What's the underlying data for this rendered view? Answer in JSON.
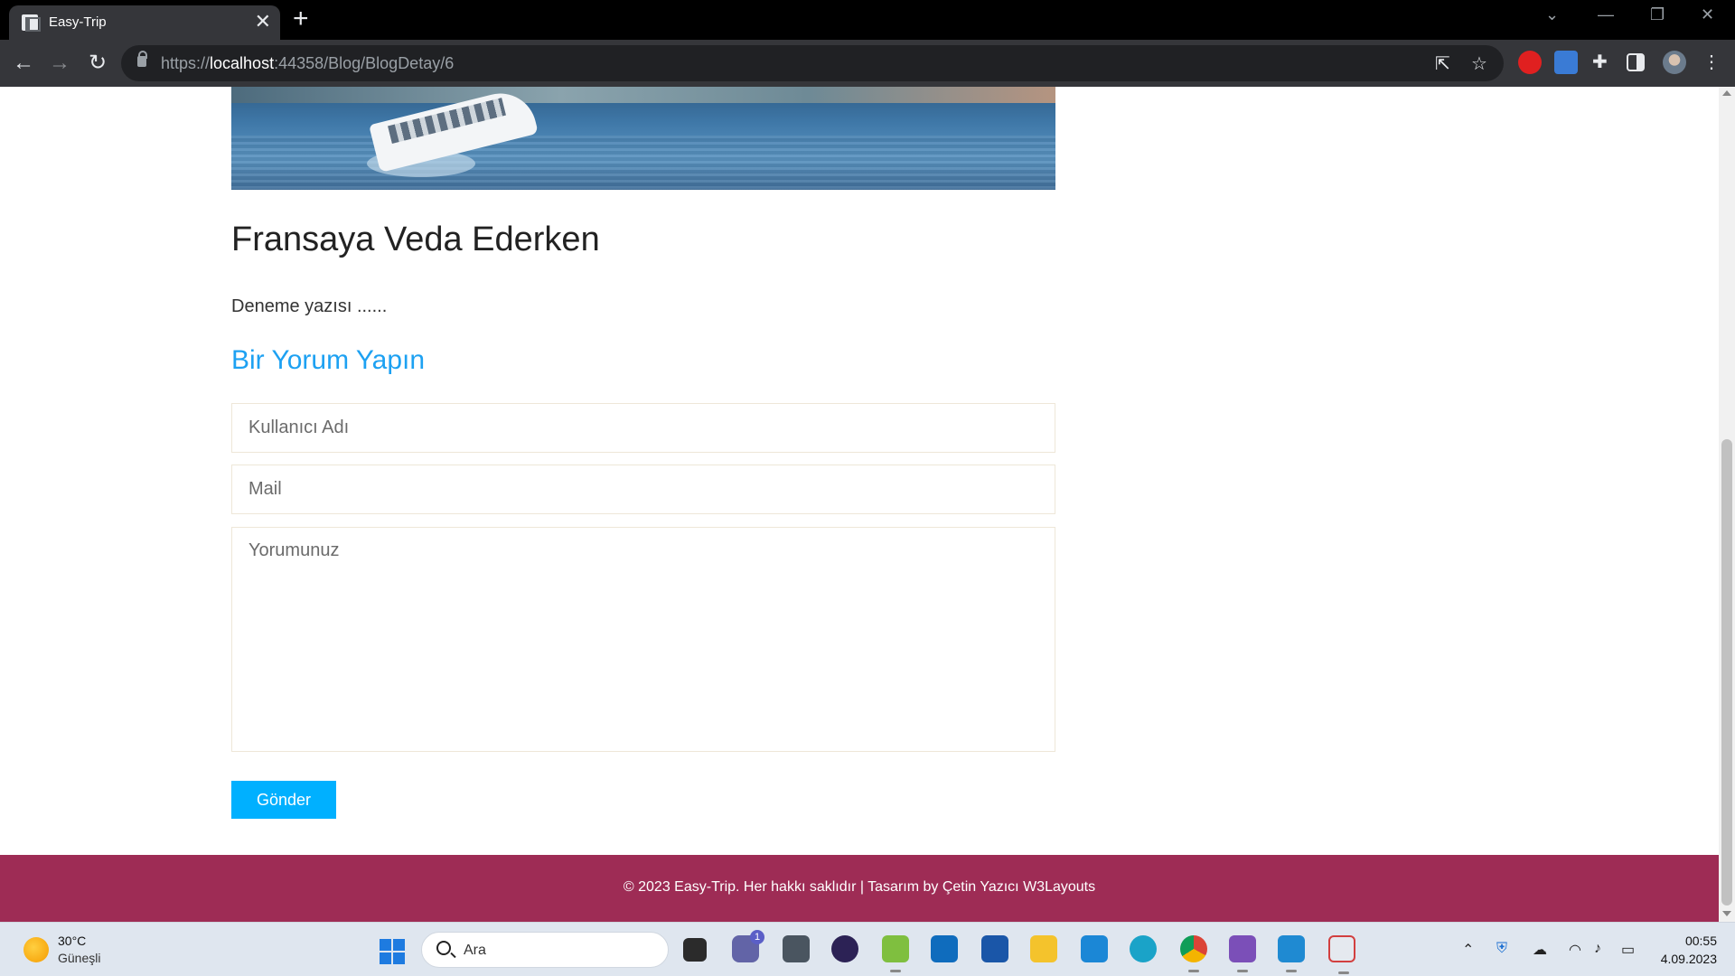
{
  "browser": {
    "tab_title": "Easy-Trip",
    "tab_close": "✕",
    "new_tab": "+",
    "url_scheme": "https://",
    "url_host": "localhost",
    "url_path": ":44358/Blog/BlogDetay/6"
  },
  "post": {
    "title": "Fransaya Veda Ederken",
    "body": "Deneme yazısı ......"
  },
  "comment_form": {
    "heading": "Bir Yorum Yapın",
    "username_placeholder": "Kullanıcı Adı",
    "mail_placeholder": "Mail",
    "comment_placeholder": "Yorumunuz",
    "submit_label": "Gönder"
  },
  "footer": {
    "text": "© 2023 Easy-Trip. Her hakkı saklıdır | Tasarım by Çetin Yazıcı W3Layouts"
  },
  "taskbar": {
    "weather_temp": "30°C",
    "weather_desc": "Güneşli",
    "search_label": "Ara",
    "clock_time": "00:55",
    "clock_date": "4.09.2023",
    "chat_badge": "1"
  },
  "colors": {
    "accent_blue": "#1da1f2",
    "button_blue": "#00b0ff",
    "footer_bg": "#9e2c55"
  }
}
